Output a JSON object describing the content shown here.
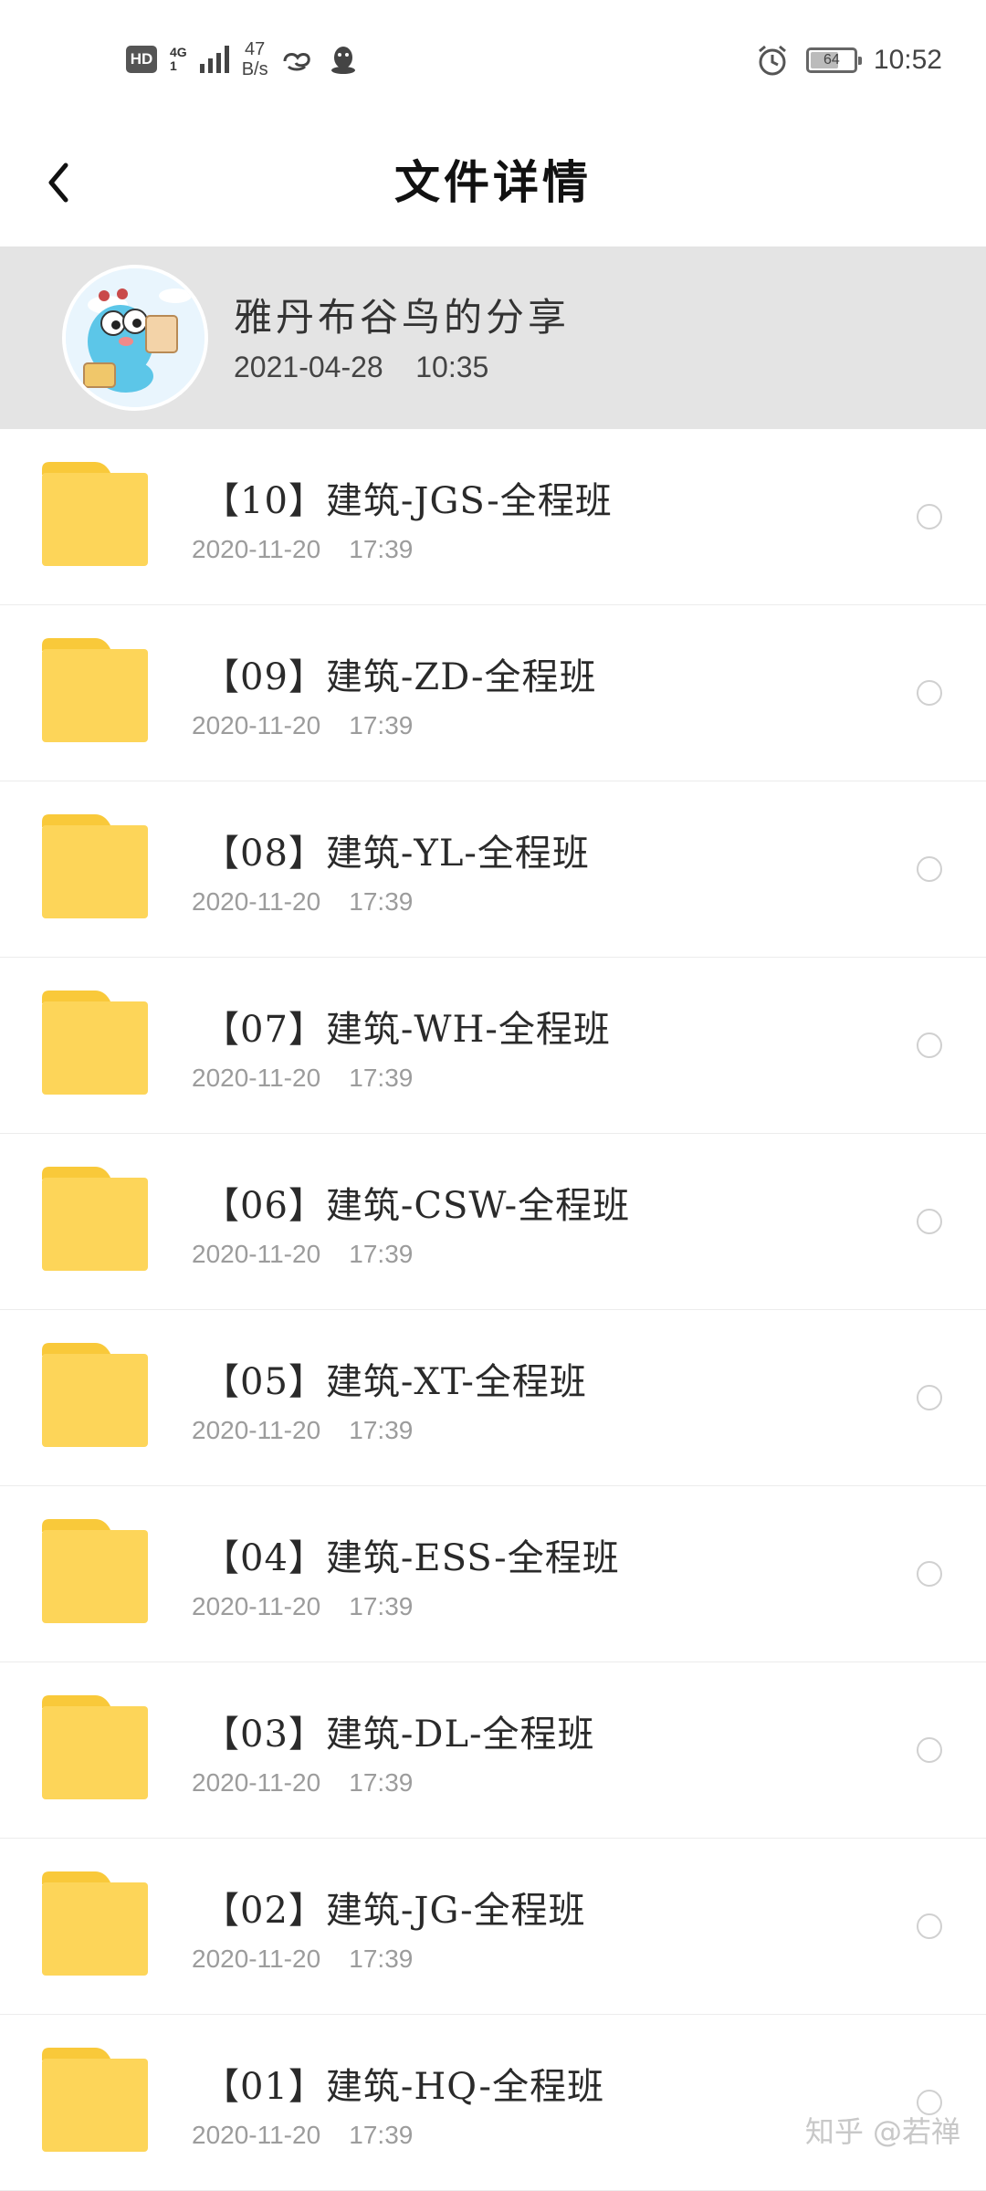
{
  "status_bar": {
    "hd_label": "HD",
    "network_type": "4G",
    "network_sub": "1",
    "speed_value": "47",
    "speed_unit": "B/s",
    "battery_level": "64",
    "time": "10:52"
  },
  "header": {
    "title": "文件详情",
    "back_icon": "chevron-left-icon"
  },
  "share": {
    "sharer_name": "雅丹布谷鸟的分享",
    "share_time": "2021-04-28    10:35"
  },
  "files": [
    {
      "name": "【10】建筑-JGS-全程班",
      "date": "2020-11-20    17:39"
    },
    {
      "name": "【09】建筑-ZD-全程班",
      "date": "2020-11-20    17:39"
    },
    {
      "name": "【08】建筑-YL-全程班",
      "date": "2020-11-20    17:39"
    },
    {
      "name": "【07】建筑-WH-全程班",
      "date": "2020-11-20    17:39"
    },
    {
      "name": "【06】建筑-CSW-全程班",
      "date": "2020-11-20    17:39"
    },
    {
      "name": "【05】建筑-XT-全程班",
      "date": "2020-11-20    17:39"
    },
    {
      "name": "【04】建筑-ESS-全程班",
      "date": "2020-11-20    17:39"
    },
    {
      "name": "【03】建筑-DL-全程班",
      "date": "2020-11-20    17:39"
    },
    {
      "name": "【02】建筑-JG-全程班",
      "date": "2020-11-20    17:39"
    },
    {
      "name": "【01】建筑-HQ-全程班",
      "date": "2020-11-20    17:39"
    }
  ],
  "watermark": "知乎 @若禅",
  "colors": {
    "folder": "#fdd559",
    "folder_tab": "#f9c93a",
    "share_card_bg": "#e4e4e4"
  }
}
